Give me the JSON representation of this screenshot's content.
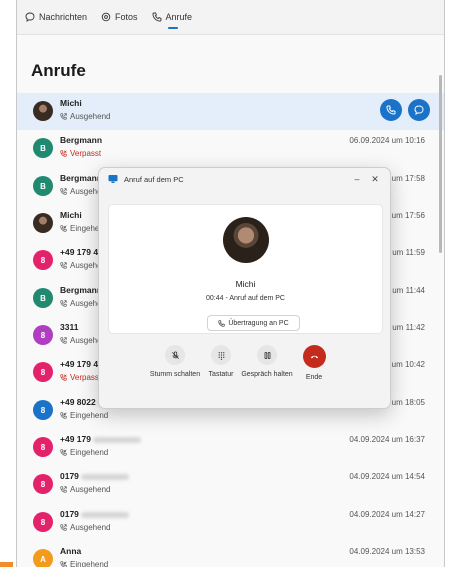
{
  "nav": {
    "tabs": [
      {
        "label": "Nachrichten",
        "icon": "chat-icon"
      },
      {
        "label": "Fotos",
        "icon": "photos-icon"
      },
      {
        "label": "Anrufe",
        "icon": "phone-icon",
        "active": true
      }
    ]
  },
  "page": {
    "title": "Anrufe"
  },
  "calls": [
    {
      "name": "Michi",
      "status": "Ausgehend",
      "type": "outgoing",
      "date": "",
      "avatar": "photo",
      "selected": true
    },
    {
      "name": "Bergmann",
      "status": "Verpasst",
      "type": "missed",
      "date": "06.09.2024 um 10:16",
      "avatar": "B",
      "color": "#1f8a70"
    },
    {
      "name": "Bergmann",
      "status": "Ausgehend",
      "type": "outgoing",
      "date": "06.09.2024 um 17:58",
      "avatar": "B",
      "color": "#1f8a70"
    },
    {
      "name": "Michi",
      "status": "Eingehend",
      "type": "incoming",
      "date": "06.09.2024 um 17:56",
      "avatar": "photo"
    },
    {
      "name": "+49 179 4",
      "status": "Ausgehend",
      "type": "outgoing",
      "date": "06.09.2024 um 11:59",
      "avatar": "8",
      "color": "#e3226b"
    },
    {
      "name": "Bergmann",
      "status": "Ausgehend",
      "type": "outgoing",
      "date": "06.09.2024 um 11:44",
      "avatar": "B",
      "color": "#1f8a70"
    },
    {
      "name": "3311",
      "status": "Ausgehend",
      "type": "outgoing",
      "date": "05.09.2024 um 11:42",
      "avatar": "8",
      "color": "#b03ec0"
    },
    {
      "name": "+49 179 4",
      "status": "Verpasst",
      "type": "missed",
      "date": "05.09.2024 um 10:42",
      "avatar": "8",
      "color": "#e3226b"
    },
    {
      "name": "+49 8022",
      "status": "Eingehend",
      "type": "incoming",
      "date": "04.09.2024 um 18:05",
      "avatar": "8",
      "color": "#1a73c8"
    },
    {
      "name": "+49 179",
      "status": "Eingehend",
      "type": "incoming",
      "date": "04.09.2024 um 16:37",
      "avatar": "8",
      "color": "#e3226b"
    },
    {
      "name": "0179",
      "status": "Ausgehend",
      "type": "outgoing",
      "date": "04.09.2024 um 14:54",
      "avatar": "8",
      "color": "#e3226b"
    },
    {
      "name": "0179",
      "status": "Ausgehend",
      "type": "outgoing",
      "date": "04.09.2024 um 14:27",
      "avatar": "8",
      "color": "#e3226b"
    },
    {
      "name": "Anna",
      "status": "Eingehend",
      "type": "incoming",
      "date": "04.09.2024 um 13:53",
      "avatar": "A",
      "color": "#f29b1d"
    }
  ],
  "dialog": {
    "title": "Anruf auf dem PC",
    "minimize": "–",
    "close": "✕",
    "contact_name": "Michi",
    "call_status": "00:44 - Anruf auf dem PC",
    "transfer_label": "Übertragung an PC",
    "controls": [
      {
        "label": "Stumm schalten",
        "icon": "mute-icon"
      },
      {
        "label": "Tastatur",
        "icon": "keypad-icon"
      },
      {
        "label": "Gespräch halten",
        "icon": "hold-icon"
      },
      {
        "label": "Ende",
        "icon": "hang-up-icon"
      }
    ]
  },
  "colors": {
    "accent": "#1a73c8",
    "missed": "#c42b1c",
    "selected_row": "#e3eefa",
    "end_call": "#c42b1c"
  }
}
